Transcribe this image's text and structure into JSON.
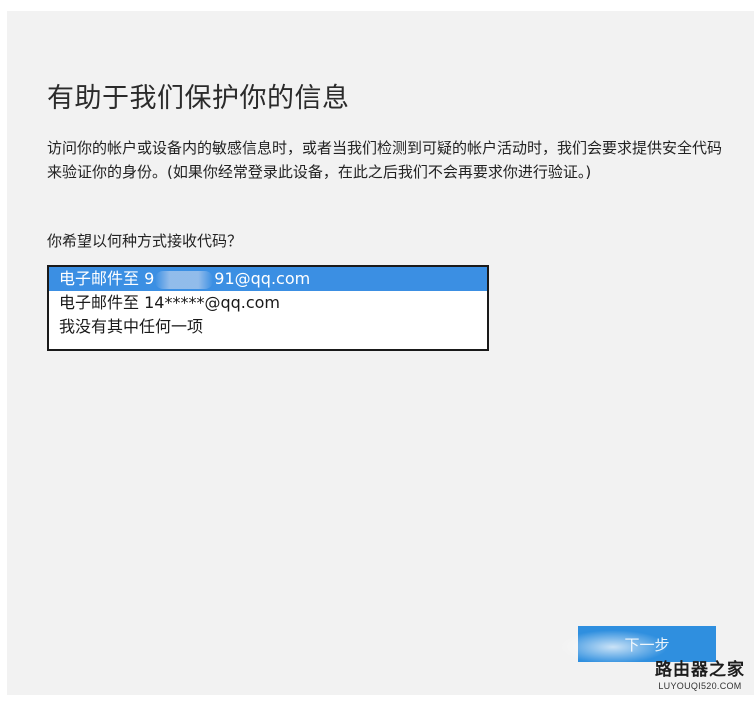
{
  "title": "有助于我们保护你的信息",
  "description": "访问你的帐户或设备内的敏感信息时，或者当我们检测到可疑的帐户活动时，我们会要求提供安全代码来验证你的身份。(如果你经常登录此设备，在此之后我们不会再要求你进行验证。)",
  "question": "你希望以何种方式接收代码？",
  "options": [
    {
      "prefix": "电子邮件至 9",
      "suffix": "91@qq.com",
      "selected": true
    },
    {
      "label": "电子邮件至 14*****@qq.com",
      "selected": false
    },
    {
      "label": "我没有其中任何一项",
      "selected": false
    }
  ],
  "next_button_label": "下一步",
  "watermark": {
    "name": "路由器之家",
    "url": "LUYOUQI520.COM"
  },
  "colors": {
    "selection": "#3b8fe3",
    "button": "#2f8fdf",
    "panel_background": "#f2f2f2"
  }
}
